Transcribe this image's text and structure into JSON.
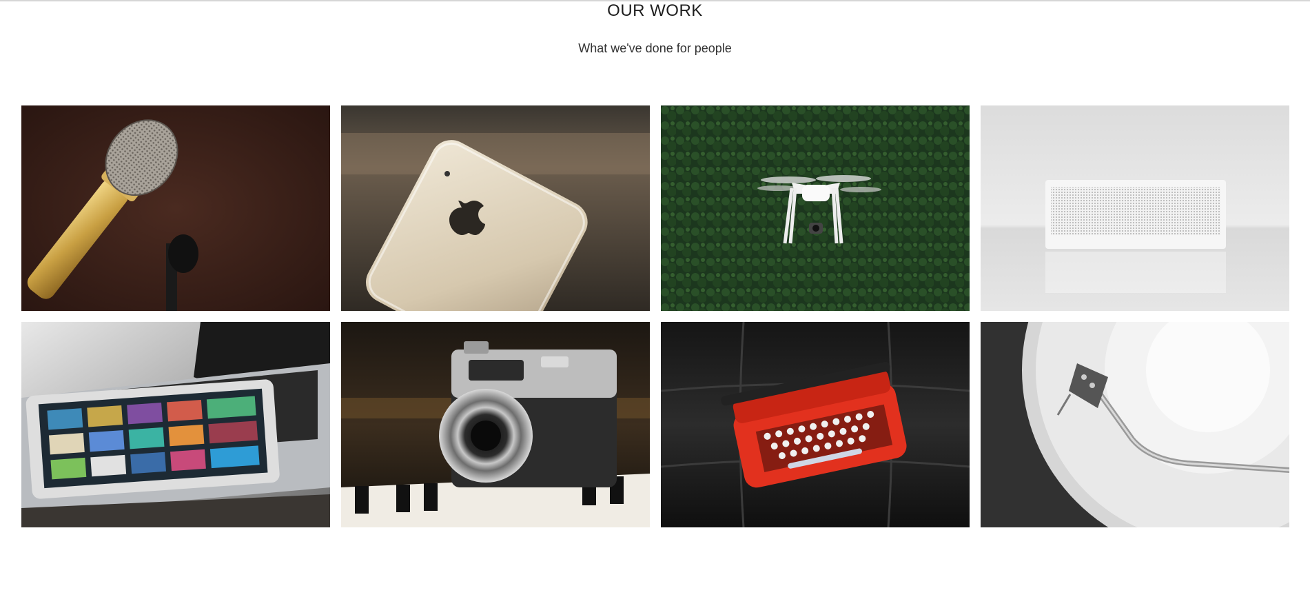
{
  "section": {
    "title": "OUR WORK",
    "subtitle": "What we've done for people"
  },
  "portfolio": {
    "items": [
      {
        "subject": "microphone",
        "icon": "microphone-photo"
      },
      {
        "subject": "smartphone",
        "icon": "smartphone-photo"
      },
      {
        "subject": "drone",
        "icon": "drone-photo"
      },
      {
        "subject": "speaker",
        "icon": "speaker-photo"
      },
      {
        "subject": "tablet-on-laptop",
        "icon": "tablet-photo"
      },
      {
        "subject": "camera",
        "icon": "camera-photo"
      },
      {
        "subject": "typewriter",
        "icon": "typewriter-photo"
      },
      {
        "subject": "turntable",
        "icon": "turntable-photo"
      }
    ]
  },
  "colors": {
    "background": "#ffffff",
    "title": "#1e1e1e",
    "subtitle": "#333333"
  }
}
